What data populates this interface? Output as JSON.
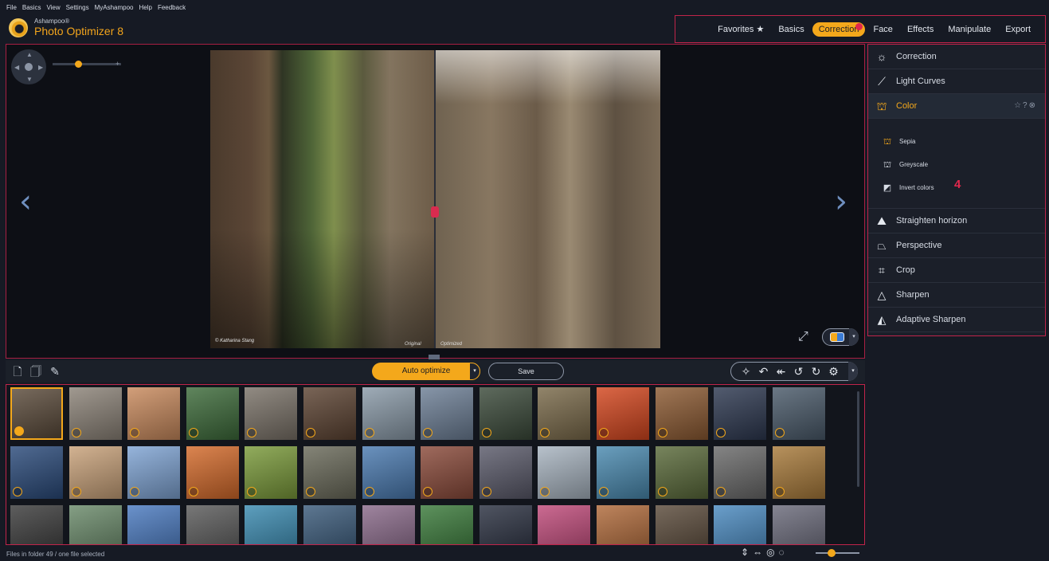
{
  "menu": [
    "File",
    "Basics",
    "View",
    "Settings",
    "MyAshampoo",
    "Help",
    "Feedback"
  ],
  "app": {
    "brand": "Ashampoo®",
    "title": "Photo Optimizer 8"
  },
  "topnav": {
    "tabs": [
      "Favorites ★",
      "Basics",
      "Correction",
      "Face",
      "Effects",
      "Manipulate",
      "Export"
    ],
    "active": "Correction"
  },
  "preview": {
    "credit": "© Katharina Stang",
    "label_original": "Original",
    "label_optimized": "Optimized"
  },
  "toolbar": {
    "auto_optimize": "Auto optimize",
    "save": "Save"
  },
  "sidepanel": {
    "items_top": [
      {
        "label": "Correction",
        "icon": "sun-icon"
      },
      {
        "label": "Light Curves",
        "icon": "curve-icon"
      },
      {
        "label": "Color",
        "icon": "paint-bucket-icon"
      }
    ],
    "color_sub": [
      {
        "label": "Sepia",
        "icon": "paint-bucket-icon",
        "color": "#f4a81b"
      },
      {
        "label": "Greyscale",
        "icon": "paint-bucket-icon",
        "color": "#cfd6e2"
      },
      {
        "label": "Invert colors",
        "icon": "invert-icon",
        "color": "#e5e9ef"
      }
    ],
    "marker": "4",
    "items_bottom": [
      {
        "label": "Straighten horizon",
        "icon": "horizon-icon"
      },
      {
        "label": "Perspective",
        "icon": "perspective-icon"
      },
      {
        "label": "Crop",
        "icon": "crop-icon"
      },
      {
        "label": "Sharpen",
        "icon": "triangle-icon"
      },
      {
        "label": "Adaptive Sharpen",
        "icon": "triangle-filled-icon"
      }
    ]
  },
  "thumbnails": {
    "rows": [
      [
        "#5a4a3a",
        "#8c8378",
        "#c98a5d",
        "#3d6b3a",
        "#7a7268",
        "#5c4332",
        "#8a9aa8",
        "#6d7f96",
        "#3b4a3a",
        "#7a6a4a",
        "#d4461e",
        "#8c5a32",
        "#2d3850",
        "#4a5a6a"
      ],
      [
        "#2a4a7a",
        "#c9a27a",
        "#7fa4d4",
        "#d46a2a",
        "#7a9a3a",
        "#6a6a5a",
        "#4a7ab0",
        "#8a4a3a",
        "#5a5a6a",
        "#a8b4c0",
        "#4a8ab0",
        "#5a6a3a",
        "#6a6a6a",
        "#a87a3a"
      ],
      [
        "#3a3a3a",
        "#6a8a6a",
        "#4a7ac0",
        "#5a5a5a",
        "#3a8ab0",
        "#3a5a7a",
        "#8a6a8a",
        "#3a7a3a",
        "#2a3040",
        "#c04a7a",
        "#b06a3a",
        "#5a4a3a",
        "#4a8ac0",
        "#6a6a7a"
      ]
    ],
    "selected_index": 0
  },
  "status": {
    "text": "Files in folder 49 / one file selected"
  }
}
